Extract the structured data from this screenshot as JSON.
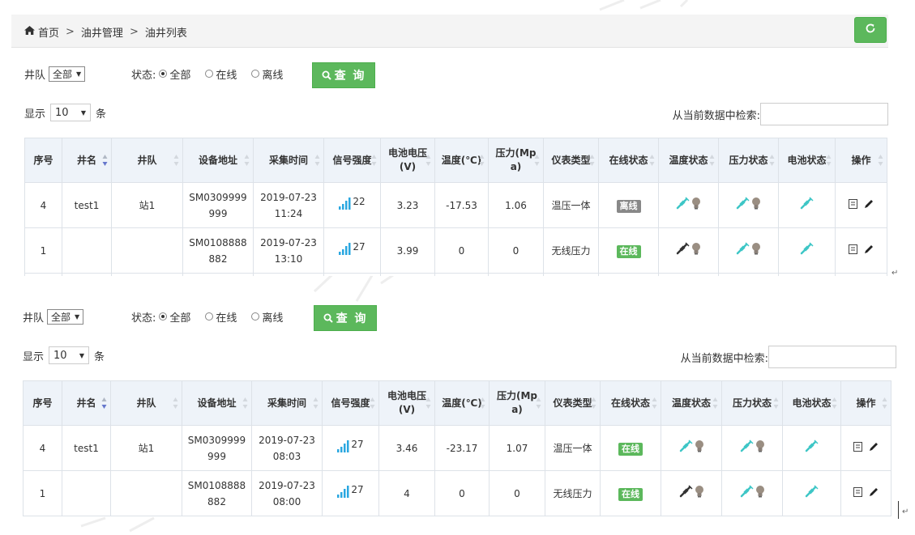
{
  "breadcrumb": {
    "items": [
      "首页",
      "油井管理",
      "油井列表"
    ],
    "separator": ">"
  },
  "panels": [
    {
      "filters": {
        "team_label": "井队",
        "team_value": "全部",
        "status_label": "状态:",
        "status_options": [
          "全部",
          "在线",
          "离线"
        ],
        "status_selected": 0,
        "query_label": "查 询"
      },
      "length": {
        "prefix": "显示",
        "value": "10",
        "suffix": "条"
      },
      "search": {
        "label": "从当前数据中检索:",
        "value": ""
      },
      "columns": [
        "序号",
        "井名",
        "井队",
        "设备地址",
        "采集时间",
        "信号强度",
        "电池电压\n(V)",
        "温度(℃)",
        "压力(Mp\na)",
        "仪表类型",
        "在线状态",
        "温度状态",
        "压力状态",
        "电池状态",
        "操作"
      ],
      "rows": [
        {
          "seq": "4",
          "name": "test1",
          "team": "站1",
          "address": "SM0309999\n999",
          "time": "2019-07-23\n11:24",
          "signal": "22",
          "voltage": "3.23",
          "temp": "-17.53",
          "pressure": "1.06",
          "meter": "温压一体",
          "online": "离线",
          "online_state": "offline",
          "temp_state": "ok"
        },
        {
          "seq": "1",
          "name": "",
          "team": "",
          "address": "SM0108888\n882",
          "time": "2019-07-23\n13:10",
          "signal": "27",
          "voltage": "3.99",
          "temp": "0",
          "pressure": "0",
          "meter": "无线压力",
          "online": "在线",
          "online_state": "online",
          "temp_state": "fault"
        }
      ]
    },
    {
      "filters": {
        "team_label": "井队",
        "team_value": "全部",
        "status_label": "状态:",
        "status_options": [
          "全部",
          "在线",
          "离线"
        ],
        "status_selected": 0,
        "query_label": "查 询"
      },
      "length": {
        "prefix": "显示",
        "value": "10",
        "suffix": "条"
      },
      "search": {
        "label": "从当前数据中检索:",
        "value": ""
      },
      "columns": [
        "序号",
        "井名",
        "井队",
        "设备地址",
        "采集时间",
        "信号强度",
        "电池电压\n(V)",
        "温度(℃)",
        "压力(Mp\na)",
        "仪表类型",
        "在线状态",
        "温度状态",
        "压力状态",
        "电池状态",
        "操作"
      ],
      "rows": [
        {
          "seq": "4",
          "name": "test1",
          "team": "站1",
          "address": "SM0309999\n999",
          "time": "2019-07-23\n08:03",
          "signal": "27",
          "voltage": "3.46",
          "temp": "-23.17",
          "pressure": "1.07",
          "meter": "温压一体",
          "online": "在线",
          "online_state": "online",
          "temp_state": "ok"
        },
        {
          "seq": "1",
          "name": "",
          "team": "",
          "address": "SM0108888\n882",
          "time": "2019-07-23\n08:00",
          "signal": "27",
          "voltage": "4",
          "temp": "0",
          "pressure": "0",
          "meter": "无线压力",
          "online": "在线",
          "online_state": "online",
          "temp_state": "fault"
        }
      ]
    }
  ],
  "colors": {
    "accent_green": "#5cb85c",
    "offline_gray": "#888888",
    "header_bg": "#eef3f9",
    "signal_blue": "#2aa7e0",
    "link_teal": "#3ec6c6"
  },
  "icons": {
    "home": "home-icon",
    "refresh": "refresh-icon",
    "search": "search-icon",
    "signal": "signal-bars-icon",
    "plug": "plug-icon",
    "bulb": "bulb-icon",
    "detail": "detail-icon",
    "edit": "pencil-icon"
  }
}
